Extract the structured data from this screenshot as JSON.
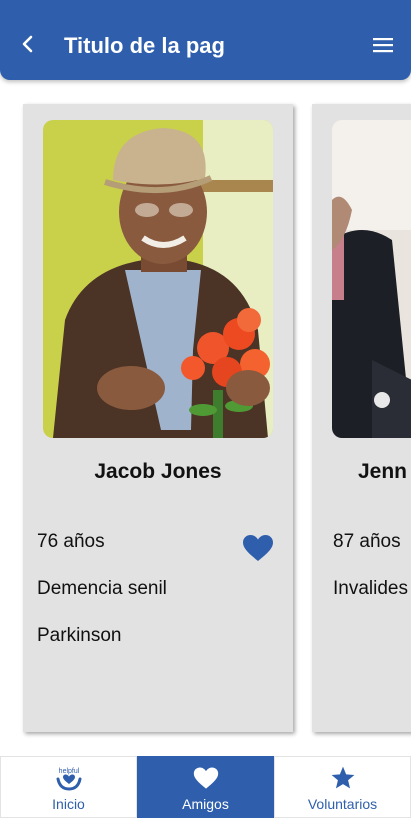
{
  "header": {
    "title": "Titulo de la pag",
    "back_icon": "arrow-back-icon",
    "menu_icon": "hamburger-menu-icon",
    "color": "#2f5fac"
  },
  "cards": [
    {
      "name": "Jacob Jones",
      "age": "76 años",
      "conditions": [
        "Demencia senil",
        "Parkinson"
      ],
      "favorite": true,
      "photo": "elderly-man-with-flat-cap-holding-orange-flowers"
    },
    {
      "name": "Jenn",
      "age": "87 años",
      "conditions": [
        "Invalides"
      ],
      "photo": "person-in-dark-suit"
    }
  ],
  "bottom_nav": {
    "items": [
      {
        "label": "Inicio",
        "icon": "helpful-logo-icon",
        "logo_text": "helpful",
        "active": false
      },
      {
        "label": "Amigos",
        "icon": "heart-icon",
        "active": true
      },
      {
        "label": "Voluntarios",
        "icon": "star-icon",
        "active": false
      }
    ]
  },
  "colors": {
    "primary": "#2f5fac",
    "card_background": "#e2e2e2",
    "text": "#111111"
  }
}
